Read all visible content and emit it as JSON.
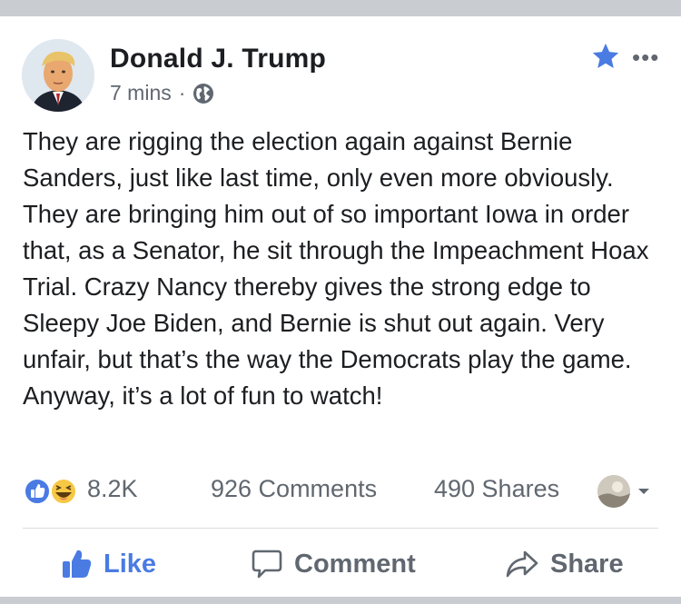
{
  "post": {
    "author": "Donald J. Trump",
    "time": "7 mins",
    "separator": "·",
    "privacy_icon": "globe-icon",
    "more_label": "•••",
    "text": "They are rigging the election again against Bernie Sanders, just like last time, only even more obviously. They are bringing him out of so important Iowa in order that, as a Senator, he sit through the Impeachment Hoax Trial. Crazy Nancy thereby gives the strong edge to Sleepy Joe Biden, and Bernie is shut out again. Very unfair, but that’s the way the Democrats play the game. Anyway, it’s a lot of fun to watch!"
  },
  "stats": {
    "reaction_icons": [
      "like-reaction-icon",
      "haha-reaction-icon"
    ],
    "reactions_count": "8.2K",
    "comments": "926 Comments",
    "shares": "490 Shares"
  },
  "actions": {
    "like": "Like",
    "comment": "Comment",
    "share": "Share"
  },
  "colors": {
    "accent": "#4a7be3",
    "text": "#1c1e21",
    "secondary": "#606770",
    "divider": "#dadde1",
    "frame": "#c9ccd1"
  }
}
